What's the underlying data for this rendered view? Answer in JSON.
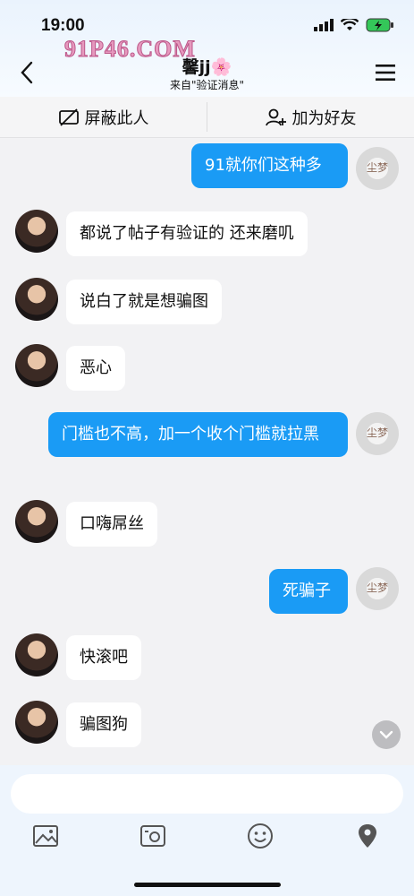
{
  "status_bar": {
    "time": "19:00"
  },
  "watermark": "91P46.COM",
  "header": {
    "title": "馨jj🌸",
    "subtitle": "来自\"验证消息\""
  },
  "actions": {
    "block_label": "屏蔽此人",
    "add_friend_label": "加为好友"
  },
  "messages": [
    {
      "sender": "me",
      "text": "91就你们这种多"
    },
    {
      "sender": "other",
      "text": "都说了帖子有验证的 还来磨叽"
    },
    {
      "sender": "other",
      "text": "说白了就是想骗图"
    },
    {
      "sender": "other",
      "text": "恶心"
    },
    {
      "sender": "me",
      "text": "门槛也不高，加一个收个门槛就拉黑"
    },
    {
      "sender": "other",
      "text": "口嗨屌丝"
    },
    {
      "sender": "me",
      "text": "死骗子"
    },
    {
      "sender": "other",
      "text": "快滚吧"
    },
    {
      "sender": "other",
      "text": "骗图狗"
    }
  ],
  "input": {
    "placeholder": ""
  },
  "colors": {
    "my_bubble": "#1a9bf5",
    "other_bubble": "#ffffff",
    "background": "#f2f2f4"
  },
  "icons": {
    "toolbar": [
      "image-icon",
      "video-icon",
      "emoji-icon",
      "location-icon"
    ]
  }
}
